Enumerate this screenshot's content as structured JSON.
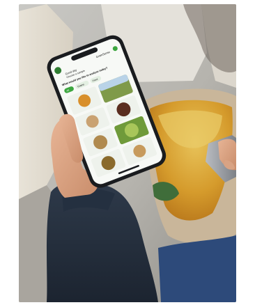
{
  "phone_app": {
    "header_brand": "GrainSense",
    "header_line1": "Good day",
    "header_line2": "Choose a sample",
    "prompt": "What would you like to analyse today?",
    "tabs": [
      "All",
      "Grains",
      "Feed"
    ]
  }
}
